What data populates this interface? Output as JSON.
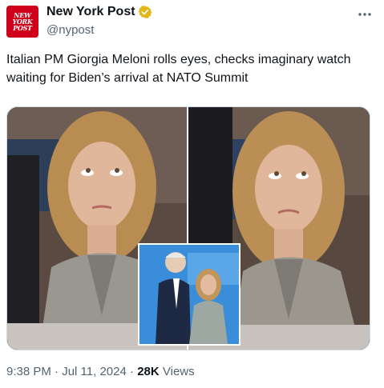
{
  "tweet": {
    "display_name": "New York Post",
    "handle": "@nypost",
    "avatar_text": [
      "NEW",
      "YORK",
      "POST"
    ],
    "text": "Italian PM Giorgia Meloni rolls eyes, checks imaginary watch waiting for Biden’s arrival at NATO Summit",
    "time": "9:38 PM",
    "date": "Jul 11, 2024",
    "separator": "·",
    "views_count": "28K",
    "views_label": "Views"
  },
  "icons": {
    "verified": "verified-gold-badge",
    "more": "more-horizontal-icon"
  },
  "colors": {
    "avatar_bg": "#d0021b",
    "verified_gold": "#e2b719",
    "secondary_text": "#536471",
    "inset_bg": "#3a8dd8"
  }
}
